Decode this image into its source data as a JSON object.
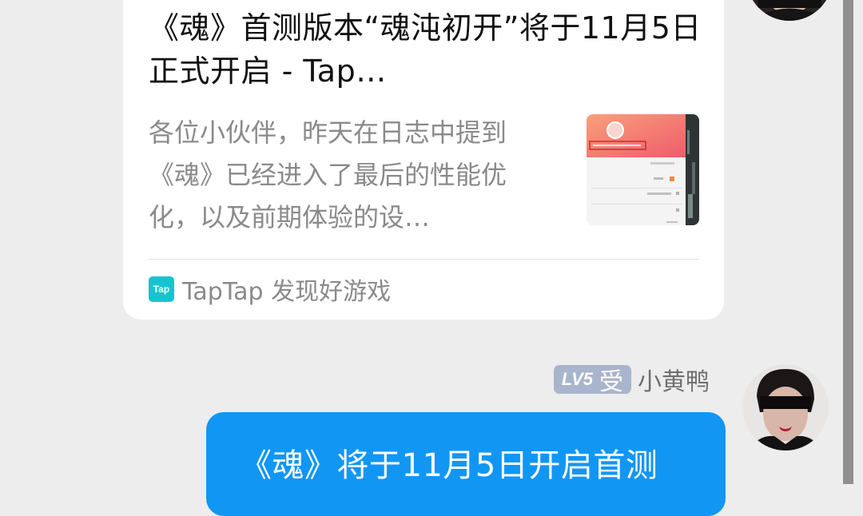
{
  "link_card": {
    "title": "《魂》首测版本“魂沌初开”将于11月5日正式开启 - Tap…",
    "description": "各位小伙伴，昨天在日志中提到《魂》已经进入了最后的性能优化，以及前期体验的设…",
    "source_logo_text": "Tap",
    "source_name": "TapTap 发现好游戏"
  },
  "sender": {
    "level": "LV5",
    "role": "受",
    "name": "小黄鸭"
  },
  "message": {
    "text": "《魂》将于11月5日开启首测"
  },
  "colors": {
    "background": "#ededed",
    "bubble": "#1296f4",
    "badge": "#a9b5cc",
    "taptap": "#15c5ce"
  }
}
